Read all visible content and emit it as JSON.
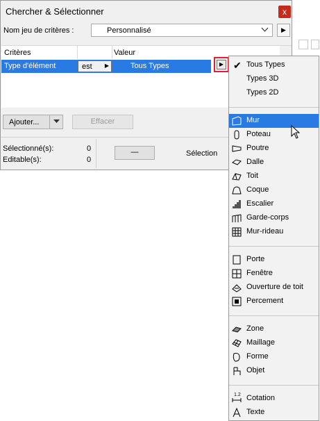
{
  "dialog": {
    "title": "Chercher & Sélectionner",
    "close": "x",
    "criteria_set_label": "Nom jeu de critères :",
    "criteria_set_value": "Personnalisé",
    "table": {
      "headers": [
        "Critères",
        "Valeur"
      ],
      "row": {
        "criterion": "Type d'élément",
        "operator": "est",
        "value": "Tous Types"
      }
    },
    "add_button": "Ajouter...",
    "clear_button": "Effacer",
    "selected_label": "Sélectionné(s):",
    "selected_count": "0",
    "editable_label": "Editable(s):",
    "editable_count": "0",
    "minus_button": "—",
    "selection_label": "Sélection"
  },
  "menu": {
    "top": [
      "Tous Types",
      "Types 3D",
      "Types 2D"
    ],
    "group1": [
      "Mur",
      "Poteau",
      "Poutre",
      "Dalle",
      "Toit",
      "Coque",
      "Escalier",
      "Garde-corps",
      "Mur-rideau"
    ],
    "group2": [
      "Porte",
      "Fenêtre",
      "Ouverture de toit",
      "Percement"
    ],
    "group3": [
      "Zone",
      "Maillage",
      "Forme",
      "Objet"
    ],
    "group4": [
      "Cotation",
      "Texte"
    ],
    "cotation_icon_text": "1.2",
    "highlighted": "Mur",
    "checked": "Tous Types"
  }
}
